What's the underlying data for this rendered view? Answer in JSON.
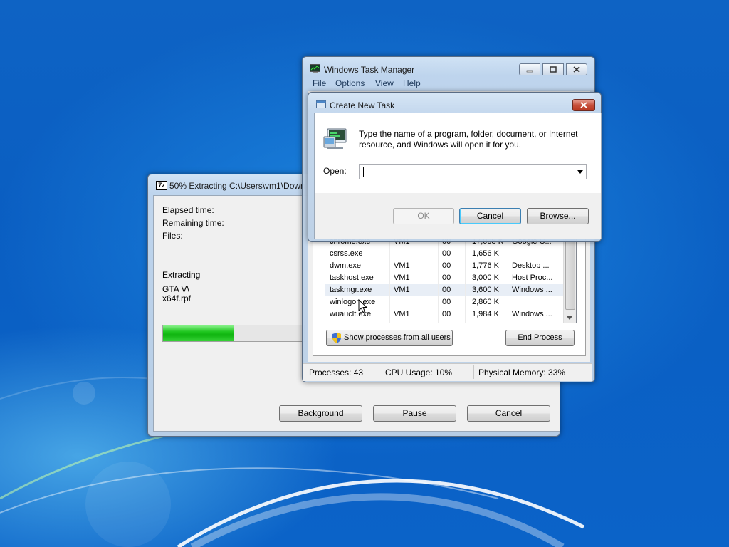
{
  "sevenzip": {
    "title": "50% Extracting C:\\Users\\vm1\\Down",
    "icon_label": "7z",
    "elapsed_label": "Elapsed time:",
    "remaining_label": "Remaining time:",
    "files_label": "Files:",
    "extracting_label": "Extracting",
    "path_line1": "GTA V\\",
    "path_line2": "x64f.rpf",
    "progress_percent": 50,
    "buttons": {
      "background": "Background",
      "pause": "Pause",
      "cancel": "Cancel"
    }
  },
  "taskmgr": {
    "title": "Windows Task Manager",
    "menu": [
      "File",
      "Options",
      "View",
      "Help"
    ],
    "processes": [
      {
        "name": "chrome.exe",
        "user": "VM1",
        "cpu": "00",
        "mem": "17,008 K",
        "desc": "Google C..."
      },
      {
        "name": "csrss.exe",
        "user": "",
        "cpu": "00",
        "mem": "1,656 K",
        "desc": ""
      },
      {
        "name": "dwm.exe",
        "user": "VM1",
        "cpu": "00",
        "mem": "1,776 K",
        "desc": "Desktop ..."
      },
      {
        "name": "taskhost.exe",
        "user": "VM1",
        "cpu": "00",
        "mem": "3,000 K",
        "desc": "Host Proc..."
      },
      {
        "name": "taskmgr.exe",
        "user": "VM1",
        "cpu": "00",
        "mem": "3,600 K",
        "desc": "Windows ..."
      },
      {
        "name": "winlogon.exe",
        "user": "",
        "cpu": "00",
        "mem": "2,860 K",
        "desc": ""
      },
      {
        "name": "wuauclt.exe",
        "user": "VM1",
        "cpu": "00",
        "mem": "1,984 K",
        "desc": "Windows ..."
      }
    ],
    "show_all_label": "Show processes from all users",
    "end_process_label": "End Process",
    "status": {
      "processes": "Processes: 43",
      "cpu": "CPU Usage: 10%",
      "memory": "Physical Memory: 33%"
    }
  },
  "run": {
    "title": "Create New Task",
    "description_line1": "Type the name of a program, folder, document, or Internet",
    "description_line2": "resource, and Windows will open it for you.",
    "open_label": "Open:",
    "open_value": "",
    "buttons": {
      "ok": "OK",
      "cancel": "Cancel",
      "browse": "Browse..."
    }
  }
}
